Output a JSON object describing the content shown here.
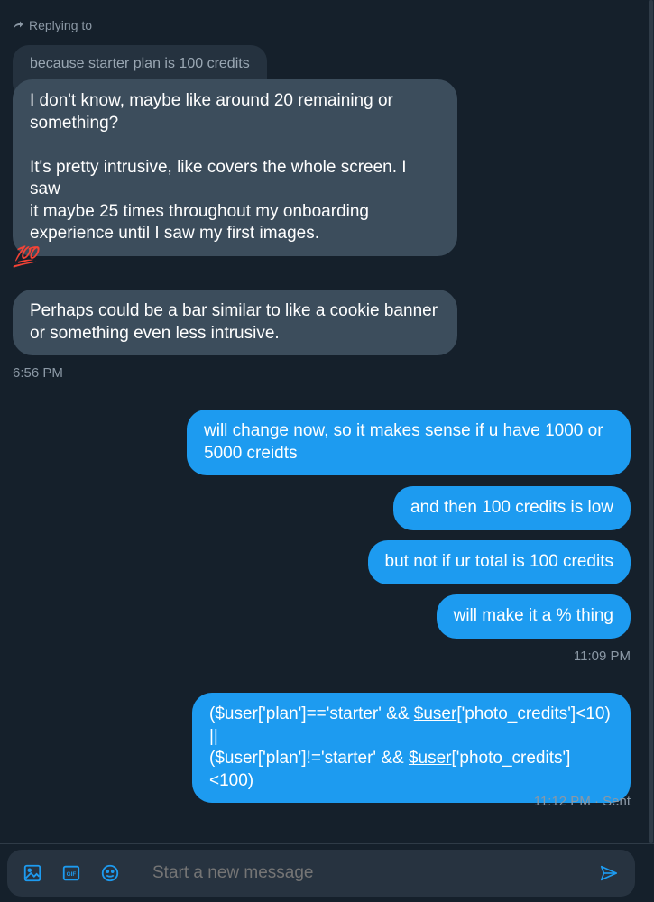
{
  "reply_context": {
    "label": "Replying to",
    "quoted_text": "because starter plan is 100 credits"
  },
  "messages": {
    "m1": "I don't know, maybe like around 20 remaining or\nsomething?\n\nIt's pretty intrusive, like covers the whole screen. I saw\nit maybe 25 times throughout my onboarding\nexperience until I saw my first images.",
    "reaction": "💯",
    "m2": "Perhaps could be a bar similar to like a cookie banner\nor something even less intrusive.",
    "time1": "6:56 PM",
    "m3": "will change now, so it makes sense if u have 1000 or\n5000 creidts",
    "m4": "and then 100 credits is low",
    "m5": "but not if ur total is 100 credits",
    "m6": "will make it a % thing",
    "time2": "11:09 PM",
    "code_line1_a": "($user['plan']=='starter' && ",
    "code_line1_link": "$user",
    "code_line1_b": "['photo_credits']<10)",
    "code_line2": "||",
    "code_line3_a": "($user['plan']!='starter' && ",
    "code_line3_link": "$user",
    "code_line3_b": "['photo_credits']<100)",
    "time3": "11:12 PM · Sent"
  },
  "composer": {
    "placeholder": "Start a new message"
  },
  "icons": {
    "image": "image-icon",
    "gif": "gif-icon",
    "emoji": "emoji-icon",
    "send": "send-icon"
  },
  "colors": {
    "background": "#15202b",
    "incoming_bubble": "#3c4d5c",
    "outgoing_bubble": "#1d9bf0",
    "accent": "#1d9bf0",
    "muted_text": "#8b98a5"
  }
}
